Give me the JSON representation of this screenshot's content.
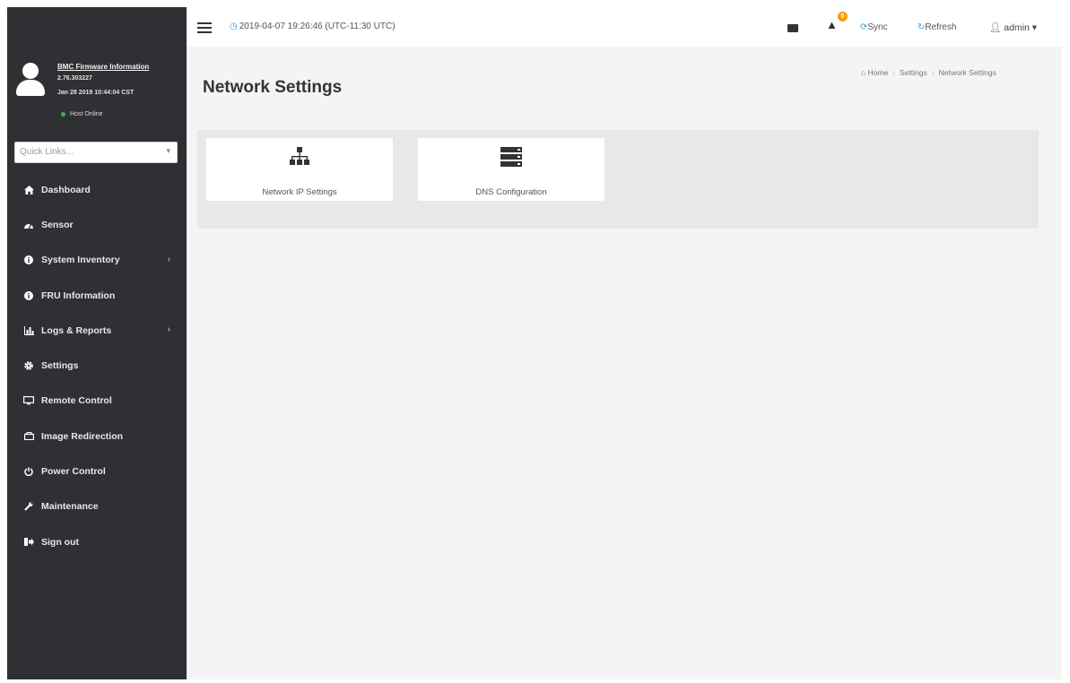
{
  "sidebar": {
    "firmware": {
      "title": "BMC Firmware Information",
      "version": "2.76.303227",
      "date": "Jan 28 2019 10:44:04 CST",
      "host_status": "Host Online"
    },
    "quick_links": {
      "placeholder": "Quick Links..."
    },
    "items": [
      {
        "label": "Dashboard",
        "icon": "dashboard-icon"
      },
      {
        "label": "Sensor",
        "icon": "sensor-icon"
      },
      {
        "label": "System Inventory",
        "icon": "info-icon",
        "has_submenu": true
      },
      {
        "label": "FRU Information",
        "icon": "info-icon"
      },
      {
        "label": "Logs & Reports",
        "icon": "bar-chart-icon",
        "has_submenu": true
      },
      {
        "label": "Settings",
        "icon": "gear-icon"
      },
      {
        "label": "Remote Control",
        "icon": "monitor-icon"
      },
      {
        "label": "Image Redirection",
        "icon": "disc-icon"
      },
      {
        "label": "Power Control",
        "icon": "power-icon"
      },
      {
        "label": "Maintenance",
        "icon": "wrench-icon"
      },
      {
        "label": "Sign out",
        "icon": "sign-out-icon"
      }
    ]
  },
  "topbar": {
    "datetime": "2019-04-07 19:26:46 (UTC-11:30 UTC)",
    "notification_count": "0",
    "sync_label": "Sync",
    "refresh_label": "Refresh",
    "user_label": "admin"
  },
  "main": {
    "title": "Network Settings",
    "breadcrumb": [
      "Home",
      "Settings",
      "Network Settings"
    ],
    "tiles": [
      {
        "label": "Network IP Settings",
        "icon": "network-icon"
      },
      {
        "label": "DNS Configuration",
        "icon": "server-icon"
      }
    ]
  },
  "colors": {
    "sidebar_bg": "#2f3033",
    "accent": "#3d9de0",
    "badge": "#f39c12",
    "status_online": "#4caf50"
  }
}
